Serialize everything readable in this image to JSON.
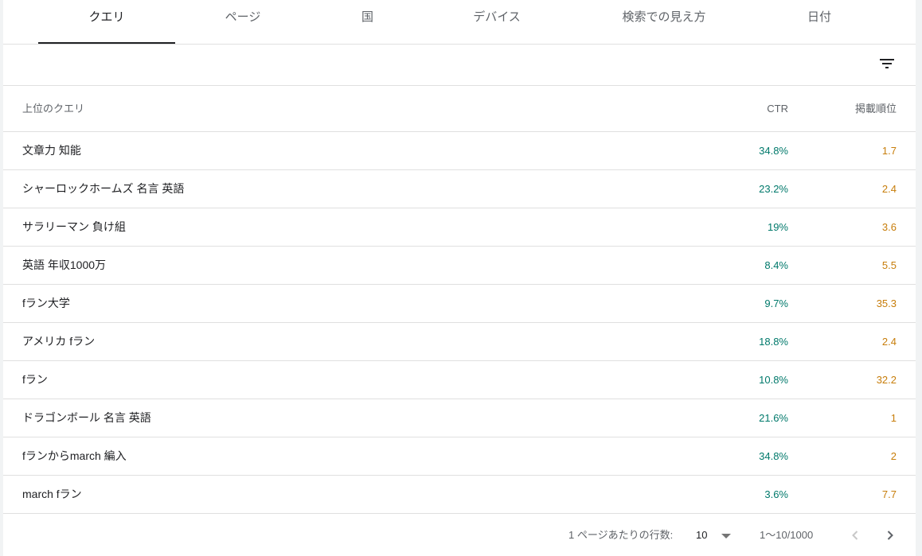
{
  "tabs": [
    {
      "label": "クエリ",
      "active": true
    },
    {
      "label": "ページ",
      "active": false
    },
    {
      "label": "国",
      "active": false
    },
    {
      "label": "デバイス",
      "active": false
    },
    {
      "label": "検索での見え方",
      "active": false
    },
    {
      "label": "日付",
      "active": false
    }
  ],
  "toolbar": {
    "filter_icon": "filter-list-icon"
  },
  "table": {
    "headers": {
      "query": "上位のクエリ",
      "ctr": "CTR",
      "position": "掲載順位"
    },
    "rows": [
      {
        "query": "文章力 知能",
        "ctr": "34.8%",
        "position": "1.7"
      },
      {
        "query": "シャーロックホームズ 名言 英語",
        "ctr": "23.2%",
        "position": "2.4"
      },
      {
        "query": "サラリーマン 負け組",
        "ctr": "19%",
        "position": "3.6"
      },
      {
        "query": "英語 年収1000万",
        "ctr": "8.4%",
        "position": "5.5"
      },
      {
        "query": "fラン大学",
        "ctr": "9.7%",
        "position": "35.3"
      },
      {
        "query": "アメリカ fラン",
        "ctr": "18.8%",
        "position": "2.4"
      },
      {
        "query": "fラン",
        "ctr": "10.8%",
        "position": "32.2"
      },
      {
        "query": "ドラゴンボール 名言 英語",
        "ctr": "21.6%",
        "position": "1"
      },
      {
        "query": "fランからmarch 編入",
        "ctr": "34.8%",
        "position": "2"
      },
      {
        "query": "march fラン",
        "ctr": "3.6%",
        "position": "7.7"
      }
    ]
  },
  "pagination": {
    "rows_per_page_label": "1 ページあたりの行数:",
    "rows_per_page_value": "10",
    "range": "1〜10/1000"
  },
  "colors": {
    "ctr": "#00796b",
    "position": "#c77d0a",
    "divider": "#e0e0e0"
  }
}
